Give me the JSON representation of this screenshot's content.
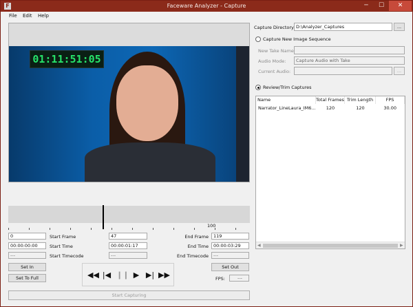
{
  "window": {
    "title": "Faceware Analyzer - Capture",
    "minimize": "─",
    "maximize": "☐",
    "close": "✕",
    "app_icon": "F"
  },
  "menu": [
    "File",
    "Edit",
    "Help"
  ],
  "video": {
    "timecode": "01:11:51:05"
  },
  "timeline": {
    "label": "100"
  },
  "left": {
    "start_frame_value": "0",
    "start_time_value": "00:00:00:00",
    "start_timecode_value": "---",
    "start_frame_label": "Start Frame",
    "start_time_label": "Start Time",
    "start_timecode_label": "Start Timecode",
    "current_frame": "47",
    "current_time": "00:00:01:17",
    "current_timecode": "---",
    "end_frame_label": "End Frame",
    "end_time_label": "End Time",
    "end_timecode_label": "End Timecode",
    "end_frame_value": "119",
    "end_time_value": "00:00:03:29",
    "end_timecode_value": "---",
    "set_in": "Set In",
    "set_to_full": "Set To Full",
    "set_out": "Set Out",
    "fps_label": "FPS:",
    "fps_value": "---",
    "start_capturing": "Start Capturing"
  },
  "transport": {
    "rewind": "◀◀",
    "prev_frame": "|◀",
    "pause": "❙❙",
    "play": "▶",
    "next_frame": "▶|",
    "fast_forward": "▶▶"
  },
  "right": {
    "capture_dir_label": "Capture Directory:",
    "capture_dir_value": "D:\\Analyzer_Captures",
    "browse": "...",
    "new_seq_label": "Capture New Image Sequence",
    "new_take_label": "New Take Name:",
    "audio_mode_label": "Audio Mode:",
    "audio_mode_value": "Capture Audio with Take",
    "current_audio_label": "Current Audio:",
    "audio_browse": "...",
    "review_label": "Review/Trim Captures"
  },
  "captures": {
    "headers": [
      "Name",
      "Total Frames",
      "Trim Length",
      "FPS"
    ],
    "rows": [
      [
        "Narrator_LineLaura_IM6...",
        "120",
        "120",
        "30.00"
      ]
    ]
  }
}
